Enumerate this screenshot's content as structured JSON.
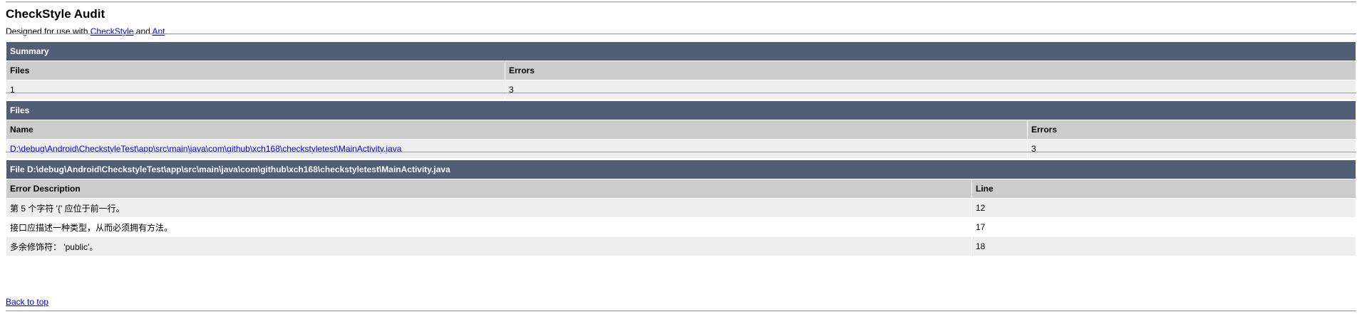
{
  "header": {
    "title": "CheckStyle Audit",
    "subtitle_prefix": "Designed for use with ",
    "checkstyle_link": "CheckStyle",
    "subtitle_middle": " and ",
    "ant_link": "Ant",
    "subtitle_suffix": "."
  },
  "summary": {
    "title": "Summary",
    "columns": [
      "Files",
      "Errors"
    ],
    "values": [
      "1",
      "3"
    ]
  },
  "files": {
    "title": "Files",
    "columns": [
      "Name",
      "Errors"
    ],
    "rows": [
      {
        "name": "D:\\debug\\Android\\CheckstyleTest\\app\\src\\main\\java\\com\\github\\xch168\\checkstyletest\\MainActivity.java",
        "errors": "3"
      }
    ]
  },
  "file_detail": {
    "title": "File D:\\debug\\Android\\CheckstyleTest\\app\\src\\main\\java\\com\\github\\xch168\\checkstyletest\\MainActivity.java",
    "columns": [
      "Error Description",
      "Line"
    ],
    "rows": [
      {
        "description": "第 5 个字符 '{' 应位于前一行。",
        "line": "12"
      },
      {
        "description": "接口应描述一种类型，从而必须拥有方法。",
        "line": "17"
      },
      {
        "description": "多余修饰符： 'public'。",
        "line": "18"
      }
    ]
  },
  "footer": {
    "back_to_top": "Back to top"
  },
  "colors": {
    "section_header_bg": "#525d76",
    "column_header_bg": "#cccccc",
    "row_alt_bg": "#eeeeee",
    "link": "#0000ee"
  }
}
